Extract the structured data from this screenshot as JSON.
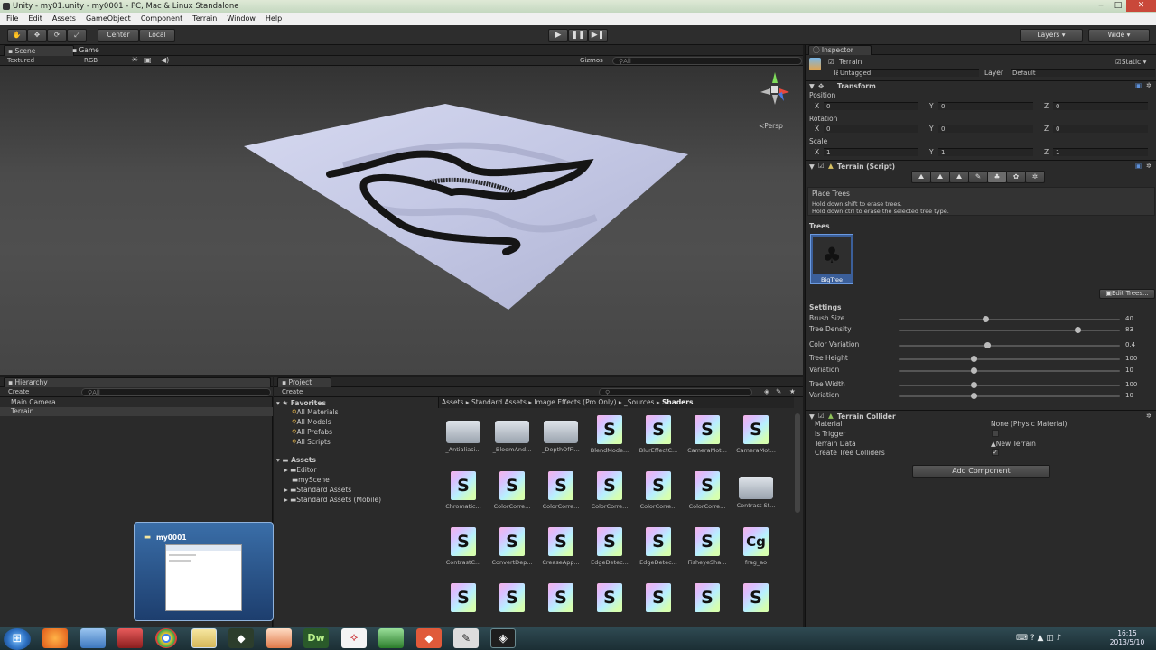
{
  "window": {
    "title": "Unity - my01.unity - my0001 - PC, Mac & Linux Standalone"
  },
  "menu": [
    "File",
    "Edit",
    "Assets",
    "GameObject",
    "Component",
    "Terrain",
    "Window",
    "Help"
  ],
  "toolbar": {
    "center": "Center",
    "local": "Local",
    "layers": "Layers",
    "layout": "Wide"
  },
  "scene": {
    "tab_scene": "Scene",
    "tab_game": "Game",
    "render_mode": "Textured",
    "color_mode": "RGB",
    "gizmos": "Gizmos",
    "search": "All",
    "persp": "Persp"
  },
  "hierarchy": {
    "tab": "Hierarchy",
    "create": "Create",
    "search": "All",
    "items": [
      "Main Camera",
      "Terrain"
    ]
  },
  "project": {
    "tab": "Project",
    "create": "Create",
    "favorites_label": "Favorites",
    "favorites": [
      "All Materials",
      "All Models",
      "All Prefabs",
      "All Scripts"
    ],
    "assets_label": "Assets",
    "assets": [
      "Editor",
      "myScene",
      "Standard Assets",
      "Standard Assets (Mobile)"
    ],
    "breadcrumb": [
      "Assets",
      "Standard Assets",
      "Image Effects (Pro Only)",
      "_Sources",
      "Shaders"
    ],
    "files": [
      {
        "name": "_Antialiasi...",
        "kind": "folder"
      },
      {
        "name": "_BloomAnd...",
        "kind": "folder"
      },
      {
        "name": "_DepthOfFi...",
        "kind": "folder"
      },
      {
        "name": "BlendMode...",
        "kind": "shader"
      },
      {
        "name": "BlurEffectC...",
        "kind": "shader"
      },
      {
        "name": "CameraMot...",
        "kind": "shader"
      },
      {
        "name": "CameraMot...",
        "kind": "shader"
      },
      {
        "name": "Chromatic...",
        "kind": "shader"
      },
      {
        "name": "ColorCorre...",
        "kind": "shader"
      },
      {
        "name": "ColorCorre...",
        "kind": "shader"
      },
      {
        "name": "ColorCorre...",
        "kind": "shader"
      },
      {
        "name": "ColorCorre...",
        "kind": "shader"
      },
      {
        "name": "ColorCorre...",
        "kind": "shader"
      },
      {
        "name": "Contrast St...",
        "kind": "folder"
      },
      {
        "name": "ContrastC...",
        "kind": "shader"
      },
      {
        "name": "ConvertDep...",
        "kind": "shader"
      },
      {
        "name": "CreaseApp...",
        "kind": "shader"
      },
      {
        "name": "EdgeDetec...",
        "kind": "shader"
      },
      {
        "name": "EdgeDetec...",
        "kind": "shader"
      },
      {
        "name": "FisheyeSha...",
        "kind": "shader"
      },
      {
        "name": "frag_ao",
        "kind": "cg"
      }
    ]
  },
  "inspector": {
    "tab": "Inspector",
    "object_name": "Terrain",
    "static": "Static",
    "tag_label": "Tag",
    "tag": "Untagged",
    "layer_label": "Layer",
    "layer": "Default",
    "transform": {
      "title": "Transform",
      "position_label": "Position",
      "rotation_label": "Rotation",
      "scale_label": "Scale",
      "position": [
        "0",
        "0",
        "0"
      ],
      "rotation": [
        "0",
        "0",
        "0"
      ],
      "scale": [
        "1",
        "1",
        "1"
      ]
    },
    "terrain_script": {
      "title": "Terrain (Script)",
      "place_trees": "Place Trees",
      "hint1": "Hold down shift to erase trees.",
      "hint2": "Hold down ctrl to erase the selected tree type.",
      "trees_label": "Trees",
      "tree_name": "BigTree",
      "edit_trees": "Edit Trees...",
      "settings_label": "Settings",
      "settings": [
        {
          "label": "Brush Size",
          "value": "40",
          "fraction": 0.39
        },
        {
          "label": "Tree Density",
          "value": "83",
          "fraction": 0.81
        },
        {
          "label": "Color Variation",
          "value": "0.4",
          "fraction": 0.4
        },
        {
          "label": "Tree Height",
          "value": "100",
          "fraction": 0.34
        },
        {
          "label": "Variation",
          "value": "10",
          "fraction": 0.34
        },
        {
          "label": "Tree Width",
          "value": "100",
          "fraction": 0.34
        },
        {
          "label": "Variation",
          "value": "10",
          "fraction": 0.34
        }
      ]
    },
    "terrain_collider": {
      "title": "Terrain Collider",
      "material_label": "Material",
      "material": "None (Physic Material)",
      "is_trigger_label": "Is Trigger",
      "terrain_data_label": "Terrain Data",
      "terrain_data": "New Terrain",
      "create_tree_colliders_label": "Create Tree Colliders"
    },
    "add_component": "Add Component"
  },
  "taskbar_preview": {
    "title": "my0001"
  },
  "clock": {
    "time": "16:15",
    "date": "2013/5/10"
  },
  "colors": {
    "accent": "#3d6fb8",
    "terrain": "#c9cde8",
    "panel": "#2a2a2a"
  }
}
